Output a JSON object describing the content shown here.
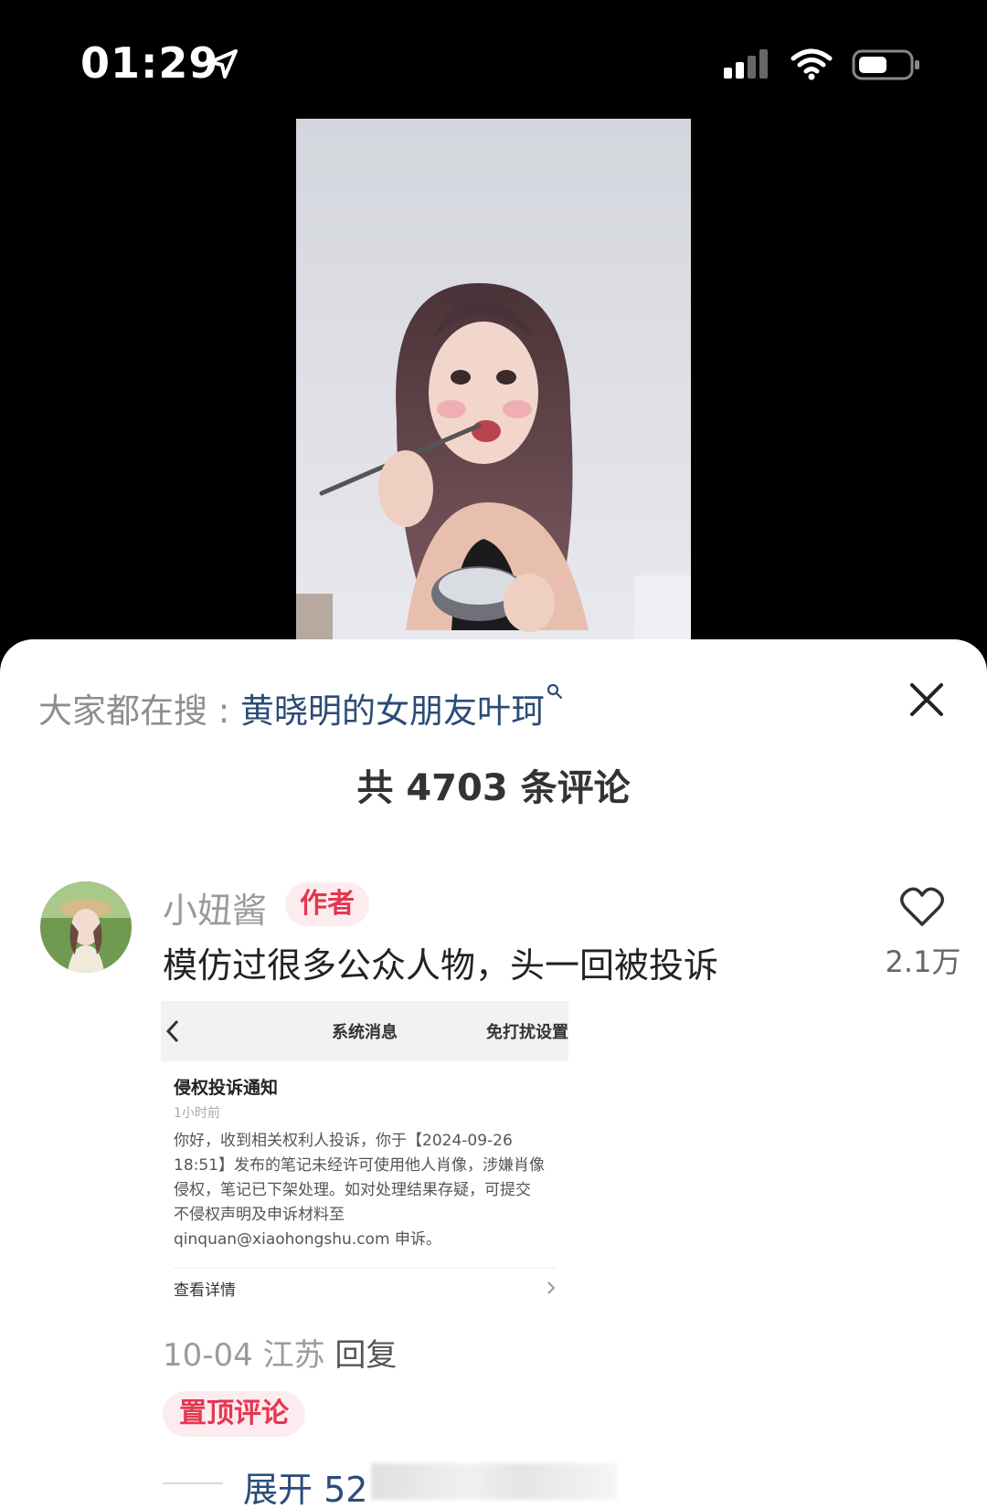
{
  "status_bar": {
    "time": "01:29"
  },
  "search_hint": {
    "prefix": "大家都在搜",
    "separator": " : ",
    "keyword": "黄晓明的女朋友叶珂"
  },
  "comment_count_label": "共 4703 条评论",
  "comment": {
    "username": "小妞酱",
    "tag": "作者",
    "text": "模仿过很多公众人物，头一回被投诉",
    "like_count": "2.1万",
    "date": "10-04",
    "location": "江苏",
    "reply_label": "回复",
    "pinned_label": "置顶评论",
    "expand_label": "展开 52"
  },
  "embedded_screenshot": {
    "header_title": "系统消息",
    "header_action": "免打扰设置",
    "notice_title": "侵权投诉通知",
    "notice_time": "1小时前",
    "message_lines": [
      "你好，收到相关权利人投诉，你于【2024-09-26",
      "18:51】发布的笔记未经许可使用他人肖像，涉嫌肖像",
      "侵权，笔记已下架处理。如对处理结果存疑，可提交",
      "不侵权声明及申诉材料至",
      "qinquan@xiaohongshu.com 申诉。"
    ],
    "details_label": "查看详情"
  },
  "colors": {
    "accent_red": "#e6364f",
    "tag_bg": "#fdecef",
    "link_blue": "#2a4c77"
  },
  "icons": [
    "location-arrow-icon",
    "signal-icon",
    "wifi-icon",
    "battery-icon",
    "search-icon",
    "close-icon",
    "heart-icon",
    "chevron-left-icon",
    "chevron-right-icon"
  ]
}
